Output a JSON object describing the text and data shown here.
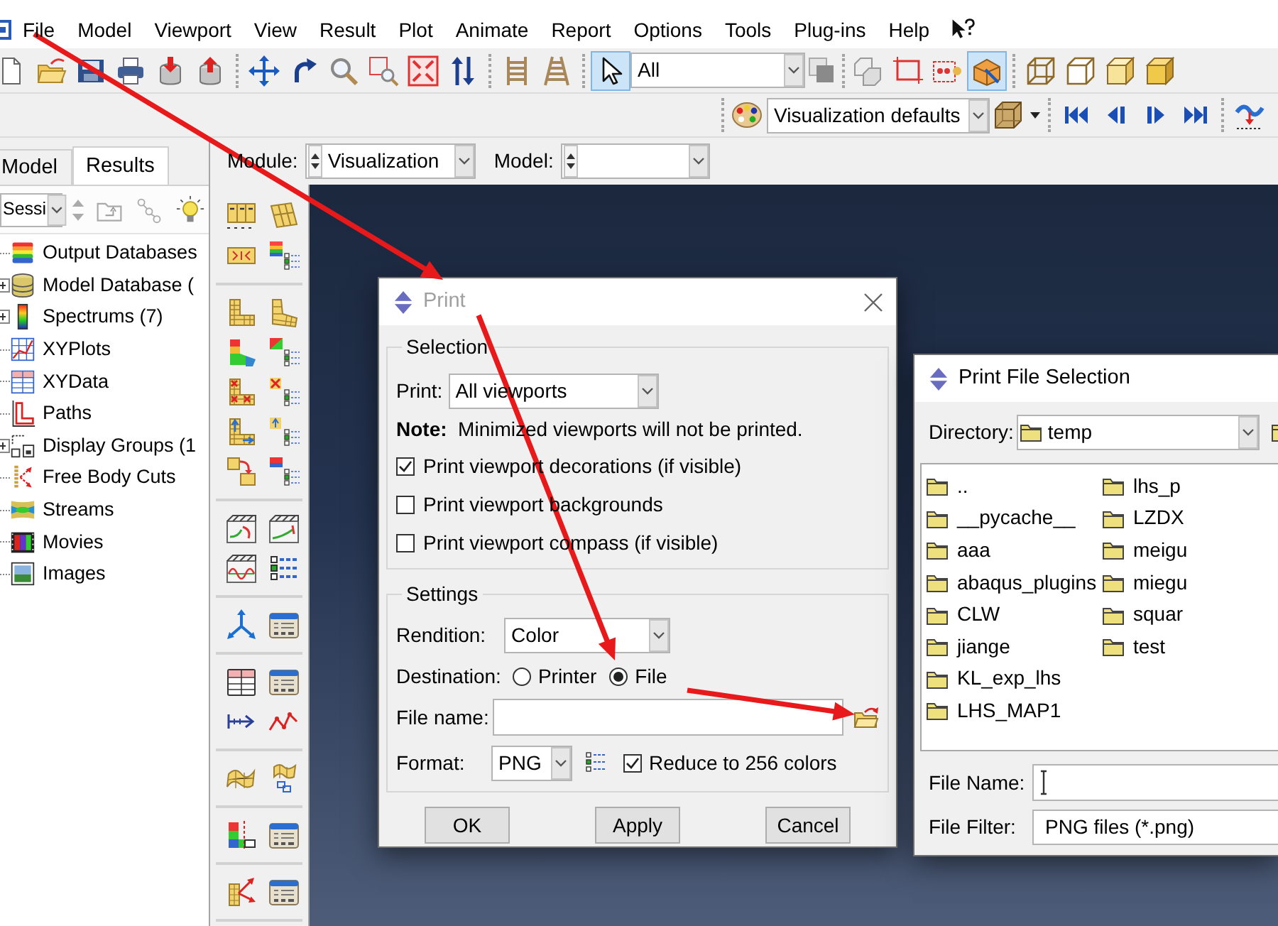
{
  "menu_bar": {
    "items": [
      "File",
      "Model",
      "Viewport",
      "View",
      "Result",
      "Plot",
      "Animate",
      "Report",
      "Options",
      "Tools",
      "Plug-ins",
      "Help"
    ]
  },
  "toolbar": {
    "select_on": true,
    "selection_filter": "All",
    "cube_pick_on": true
  },
  "display_toolbar": {
    "options": "Visualization defaults"
  },
  "context_bar": {
    "module_label": "Module:",
    "module": "Visualization",
    "model_label": "Model:"
  },
  "left_panel": {
    "tabs": [
      {
        "label": "Model",
        "selected": false
      },
      {
        "label": "Results",
        "selected": true
      }
    ],
    "filter": "Sessi",
    "tree": [
      {
        "label": "Output Databases",
        "kind": "item"
      },
      {
        "label": "Model Database (",
        "kind": "group",
        "expanded": false
      },
      {
        "label": "Spectrums (7)",
        "kind": "group",
        "expanded": false
      },
      {
        "label": "XYPlots",
        "kind": "item"
      },
      {
        "label": "XYData",
        "kind": "item"
      },
      {
        "label": "Paths",
        "kind": "item"
      },
      {
        "label": "Display Groups (1",
        "kind": "group",
        "expanded": false
      },
      {
        "label": "Free Body Cuts",
        "kind": "item"
      },
      {
        "label": "Streams",
        "kind": "item"
      },
      {
        "label": "Movies",
        "kind": "item"
      },
      {
        "label": "Images",
        "kind": "item"
      }
    ]
  },
  "print_dialog": {
    "title": "Print",
    "active": false,
    "selection_title": "Selection",
    "print_label": "Print:",
    "print_value": "All viewports",
    "note": "**Note:**  Minimized viewports will not be printed.",
    "options": [
      {
        "label": "Print viewport decorations (if visible)",
        "checked": true
      },
      {
        "label": "Print viewport backgrounds",
        "checked": false
      },
      {
        "label": "Print viewport compass (if visible)",
        "checked": false
      }
    ],
    "settings_title": "Settings",
    "rendition_label": "Rendition:",
    "rendition": "Color",
    "destination_label": "Destination:",
    "destinations": [
      {
        "label": "Printer",
        "selected": false
      },
      {
        "label": "File",
        "selected": true
      }
    ],
    "file_name_label": "File name:",
    "format_label": "Format:",
    "format": "PNG",
    "reduce_colors": {
      "label": "Reduce to 256 colors",
      "checked": true
    },
    "buttons": [
      "OK",
      "Apply",
      "Cancel"
    ]
  },
  "file_dialog": {
    "title": "Print File Selection",
    "active": true,
    "directory_label": "Directory:",
    "directory": "temp",
    "entries": [
      "..",
      "__pycache__",
      "aaa",
      "abaqus_plugins",
      "CLW",
      "jiange",
      "KL_exp_lhs",
      "LHS_MAP1",
      "lhs_p",
      "LZDX",
      "meigu",
      "miegu",
      "squar",
      "test"
    ],
    "file_name_label": "File Name:",
    "filter_label": "File Filter:",
    "filter": "PNG files (*.png)"
  }
}
